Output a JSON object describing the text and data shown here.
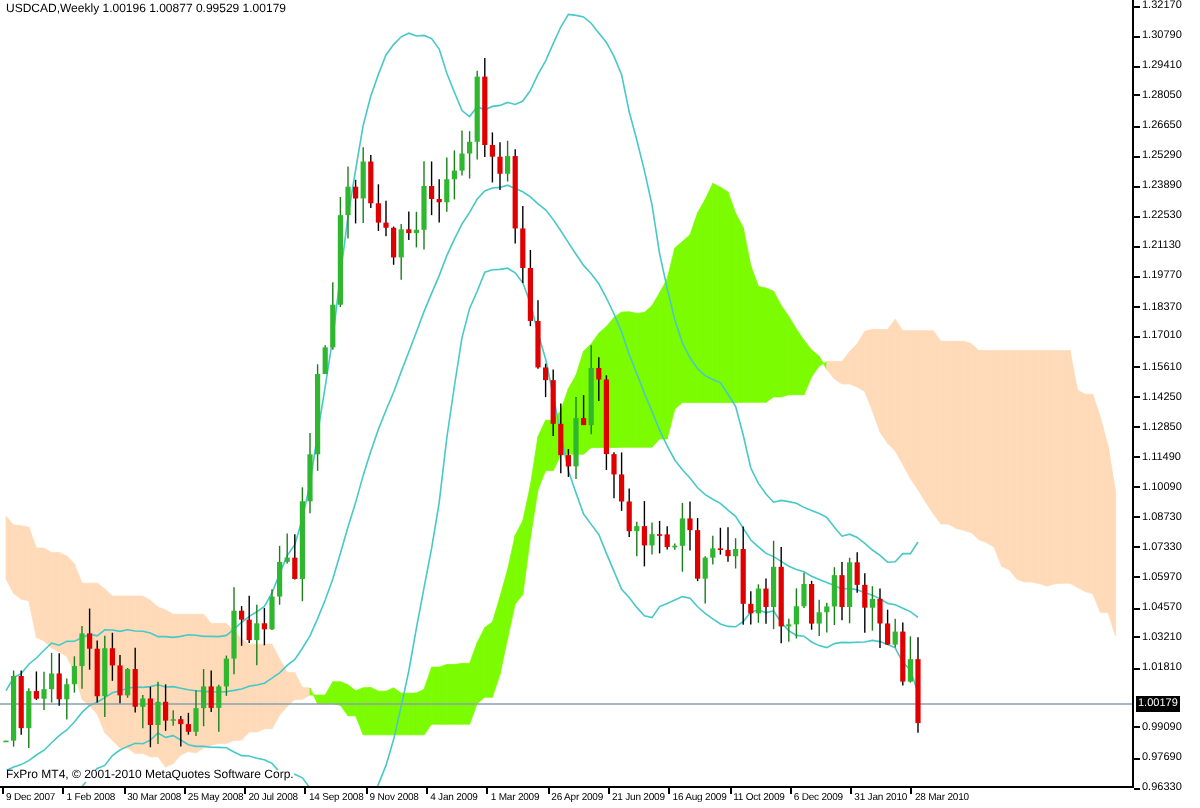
{
  "chart": {
    "symbol_line": "USDCAD,Weekly 1.00196 1.00877 0.99529 1.00179",
    "copyright": "FxPro MT4, © 2001-2010 MetaQuotes Software Corp.",
    "price_ticks": [
      "1.32170",
      "1.30790",
      "1.29410",
      "1.28050",
      "1.26650",
      "1.25290",
      "1.23890",
      "1.22530",
      "1.21130",
      "1.19770",
      "1.18370",
      "1.17010",
      "1.15610",
      "1.14250",
      "1.12850",
      "1.11490",
      "1.10090",
      "1.08730",
      "1.07330",
      "1.05970",
      "1.04570",
      "1.03210",
      "1.01810",
      "0.99090",
      "0.97690",
      "0.96330"
    ],
    "current_price": "1.00179",
    "date_ticks": [
      "9 Dec 2007",
      "1 Feb 2008",
      "30 Mar 2008",
      "25 May 2008",
      "20 Jul 2008",
      "14 Sep 2008",
      "9 Nov 2008",
      "4 Jan 2009",
      "1 Mar 2009",
      "26 Apr 2009",
      "21 Jun 2009",
      "16 Aug 2009",
      "11 Oct 2009",
      "6 Dec 2009",
      "31 Jan 2010",
      "28 Mar 2010"
    ]
  }
}
